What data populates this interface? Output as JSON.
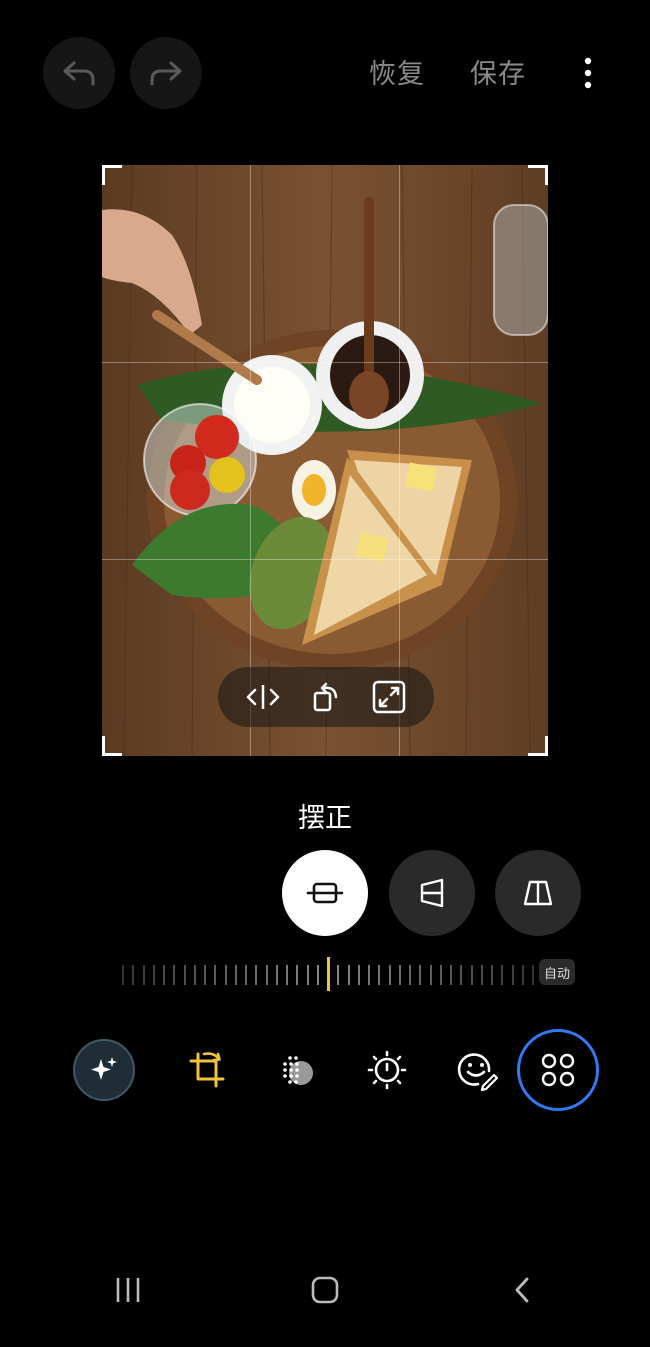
{
  "header": {
    "undo_icon": "undo-arrow-icon",
    "redo_icon": "redo-arrow-icon",
    "revert_label": "恢复",
    "save_label": "保存",
    "more_icon": "more-vertical-icon"
  },
  "photo_toolbar": {
    "icons": [
      "flip-horizontal-icon",
      "rotate-icon",
      "expand-icon"
    ]
  },
  "straighten": {
    "label": "摆正",
    "modes": [
      "straighten-icon",
      "vertical-perspective-icon",
      "horizontal-perspective-icon"
    ],
    "auto_label": "自动",
    "accent_color": "#f4c33c"
  },
  "tools": {
    "items": [
      "auto-enhance-icon",
      "crop-rotate-icon",
      "filters-icon",
      "adjust-light-icon",
      "sticker-emoji-icon",
      "more-tools-icon"
    ],
    "active_ring_color": "#2f7bf5"
  },
  "navbar": {
    "icons": [
      "recents-icon",
      "home-icon",
      "back-icon"
    ]
  }
}
